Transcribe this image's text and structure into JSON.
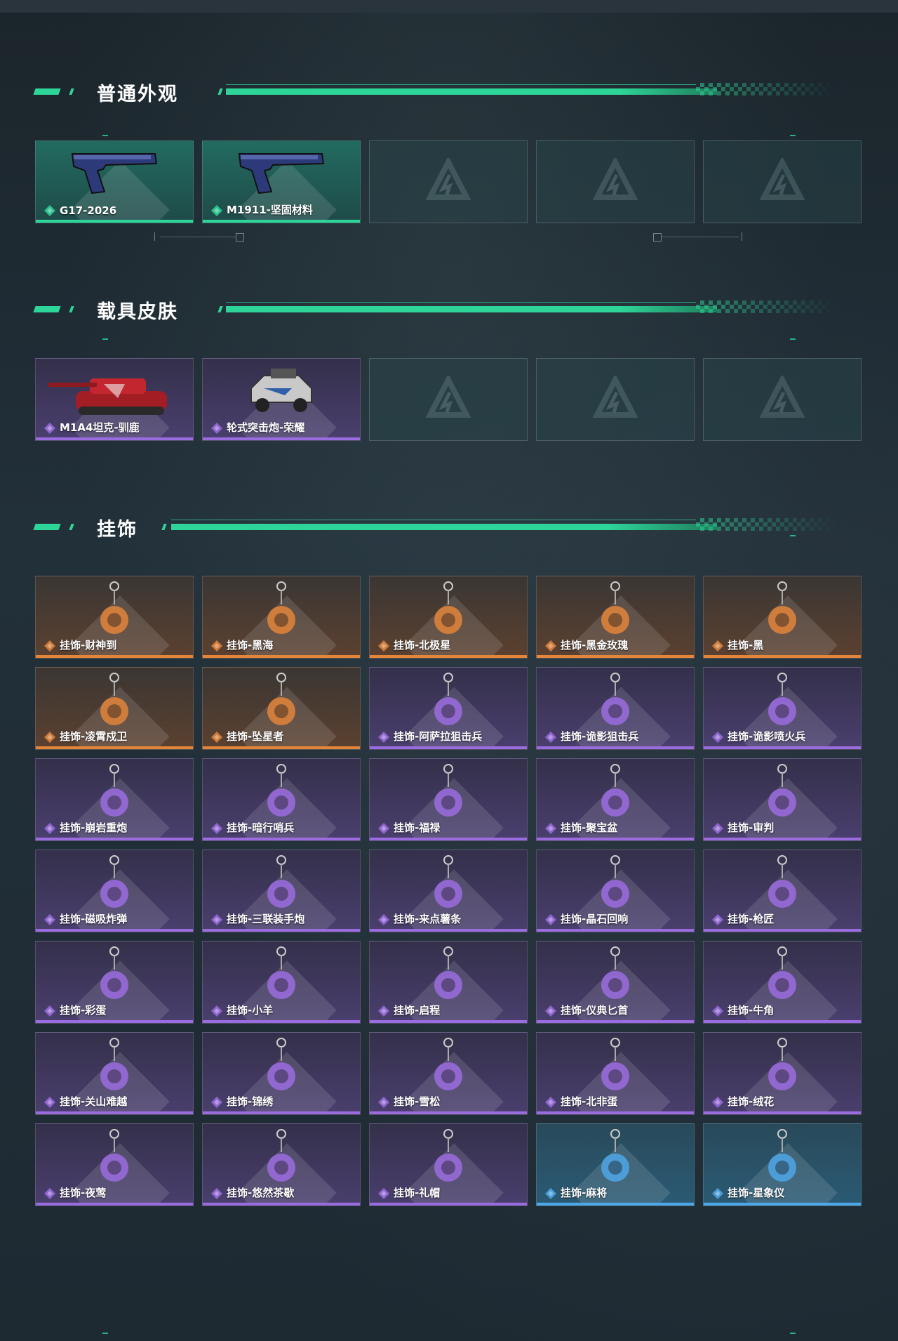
{
  "sections": [
    {
      "title": "普通外观",
      "items": [
        {
          "label": "G17-2026",
          "rarity": "teal",
          "icon": "pistol-icon"
        },
        {
          "label": "M1911-坚固材料",
          "rarity": "teal",
          "icon": "pistol-icon"
        },
        {
          "label": "",
          "rarity": "empty",
          "icon": "logo-icon"
        },
        {
          "label": "",
          "rarity": "empty",
          "icon": "logo-icon"
        },
        {
          "label": "",
          "rarity": "empty",
          "icon": "logo-icon"
        }
      ]
    },
    {
      "title": "载具皮肤",
      "items": [
        {
          "label": "M1A4坦克-驯鹿",
          "rarity": "purple",
          "icon": "tank-icon"
        },
        {
          "label": "轮式突击炮-荣耀",
          "rarity": "purple",
          "icon": "armored-car-icon"
        },
        {
          "label": "",
          "rarity": "empty",
          "icon": "logo-icon"
        },
        {
          "label": "",
          "rarity": "empty",
          "icon": "logo-icon"
        },
        {
          "label": "",
          "rarity": "empty",
          "icon": "logo-icon"
        }
      ]
    },
    {
      "title": "挂饰",
      "items": [
        {
          "label": "挂饰-财神到",
          "rarity": "orange",
          "icon": "charm-icon"
        },
        {
          "label": "挂饰-黑海",
          "rarity": "orange",
          "icon": "anchor-charm-icon"
        },
        {
          "label": "挂饰-北极星",
          "rarity": "orange",
          "icon": "star-charm-icon"
        },
        {
          "label": "挂饰-黑金玫瑰",
          "rarity": "orange",
          "icon": "rose-charm-icon"
        },
        {
          "label": "挂饰-黑",
          "rarity": "orange",
          "icon": "tag-charm-icon"
        },
        {
          "label": "挂饰-凌霄戍卫",
          "rarity": "orange",
          "icon": "charm-icon"
        },
        {
          "label": "挂饰-坠星者",
          "rarity": "orange",
          "icon": "crystal-charm-icon"
        },
        {
          "label": "挂饰-阿萨拉狙击兵",
          "rarity": "purple",
          "icon": "figure-charm-icon"
        },
        {
          "label": "挂饰-诡影狙击兵",
          "rarity": "purple",
          "icon": "figure-charm-icon"
        },
        {
          "label": "挂饰-诡影喷火兵",
          "rarity": "purple",
          "icon": "figure-charm-icon"
        },
        {
          "label": "挂饰-崩岩重炮",
          "rarity": "purple",
          "icon": "figure-charm-icon"
        },
        {
          "label": "挂饰-暗行哨兵",
          "rarity": "purple",
          "icon": "figure-charm-icon"
        },
        {
          "label": "挂饰-福禄",
          "rarity": "purple",
          "icon": "charm-icon"
        },
        {
          "label": "挂饰-聚宝盆",
          "rarity": "purple",
          "icon": "charm-icon"
        },
        {
          "label": "挂饰-审判",
          "rarity": "purple",
          "icon": "card-charm-icon"
        },
        {
          "label": "挂饰-磁吸炸弹",
          "rarity": "purple",
          "icon": "bomb-charm-icon"
        },
        {
          "label": "挂饰-三联装手炮",
          "rarity": "purple",
          "icon": "launcher-charm-icon"
        },
        {
          "label": "挂饰-来点薯条",
          "rarity": "purple",
          "icon": "fries-charm-icon"
        },
        {
          "label": "挂饰-晶石回响",
          "rarity": "purple",
          "icon": "crystal-charm-icon"
        },
        {
          "label": "挂饰-枪匠",
          "rarity": "purple",
          "icon": "box-charm-icon"
        },
        {
          "label": "挂饰-彩蛋",
          "rarity": "purple",
          "icon": "egg-charm-icon"
        },
        {
          "label": "挂饰-小羊",
          "rarity": "purple",
          "icon": "sheep-charm-icon"
        },
        {
          "label": "挂饰-启程",
          "rarity": "purple",
          "icon": "medal-charm-icon"
        },
        {
          "label": "挂饰-仪典匕首",
          "rarity": "purple",
          "icon": "dagger-charm-icon"
        },
        {
          "label": "挂饰-牛角",
          "rarity": "purple",
          "icon": "horns-charm-icon"
        },
        {
          "label": "挂饰-关山难越",
          "rarity": "purple",
          "icon": "scroll-charm-icon"
        },
        {
          "label": "挂饰-锦绣",
          "rarity": "purple",
          "icon": "butterfly-charm-icon"
        },
        {
          "label": "挂饰-雪松",
          "rarity": "purple",
          "icon": "tree-charm-icon"
        },
        {
          "label": "挂饰-北非蛋",
          "rarity": "purple",
          "icon": "food-charm-icon"
        },
        {
          "label": "挂饰-绒花",
          "rarity": "purple",
          "icon": "flower-charm-icon"
        },
        {
          "label": "挂饰-夜莺",
          "rarity": "purple",
          "icon": "bird-charm-icon"
        },
        {
          "label": "挂饰-悠然茶歇",
          "rarity": "purple",
          "icon": "cupcake-charm-icon"
        },
        {
          "label": "挂饰-礼帽",
          "rarity": "purple",
          "icon": "hat-charm-icon"
        },
        {
          "label": "挂饰-麻将",
          "rarity": "blue",
          "icon": "mahjong-charm-icon"
        },
        {
          "label": "挂饰-星象仪",
          "rarity": "blue",
          "icon": "orb-charm-icon"
        }
      ]
    }
  ],
  "colors": {
    "accent": "#2ed598",
    "teal": "#2ed598",
    "purple": "#9b6ce0",
    "orange": "#e3853a",
    "blue": "#4ea7e8"
  }
}
